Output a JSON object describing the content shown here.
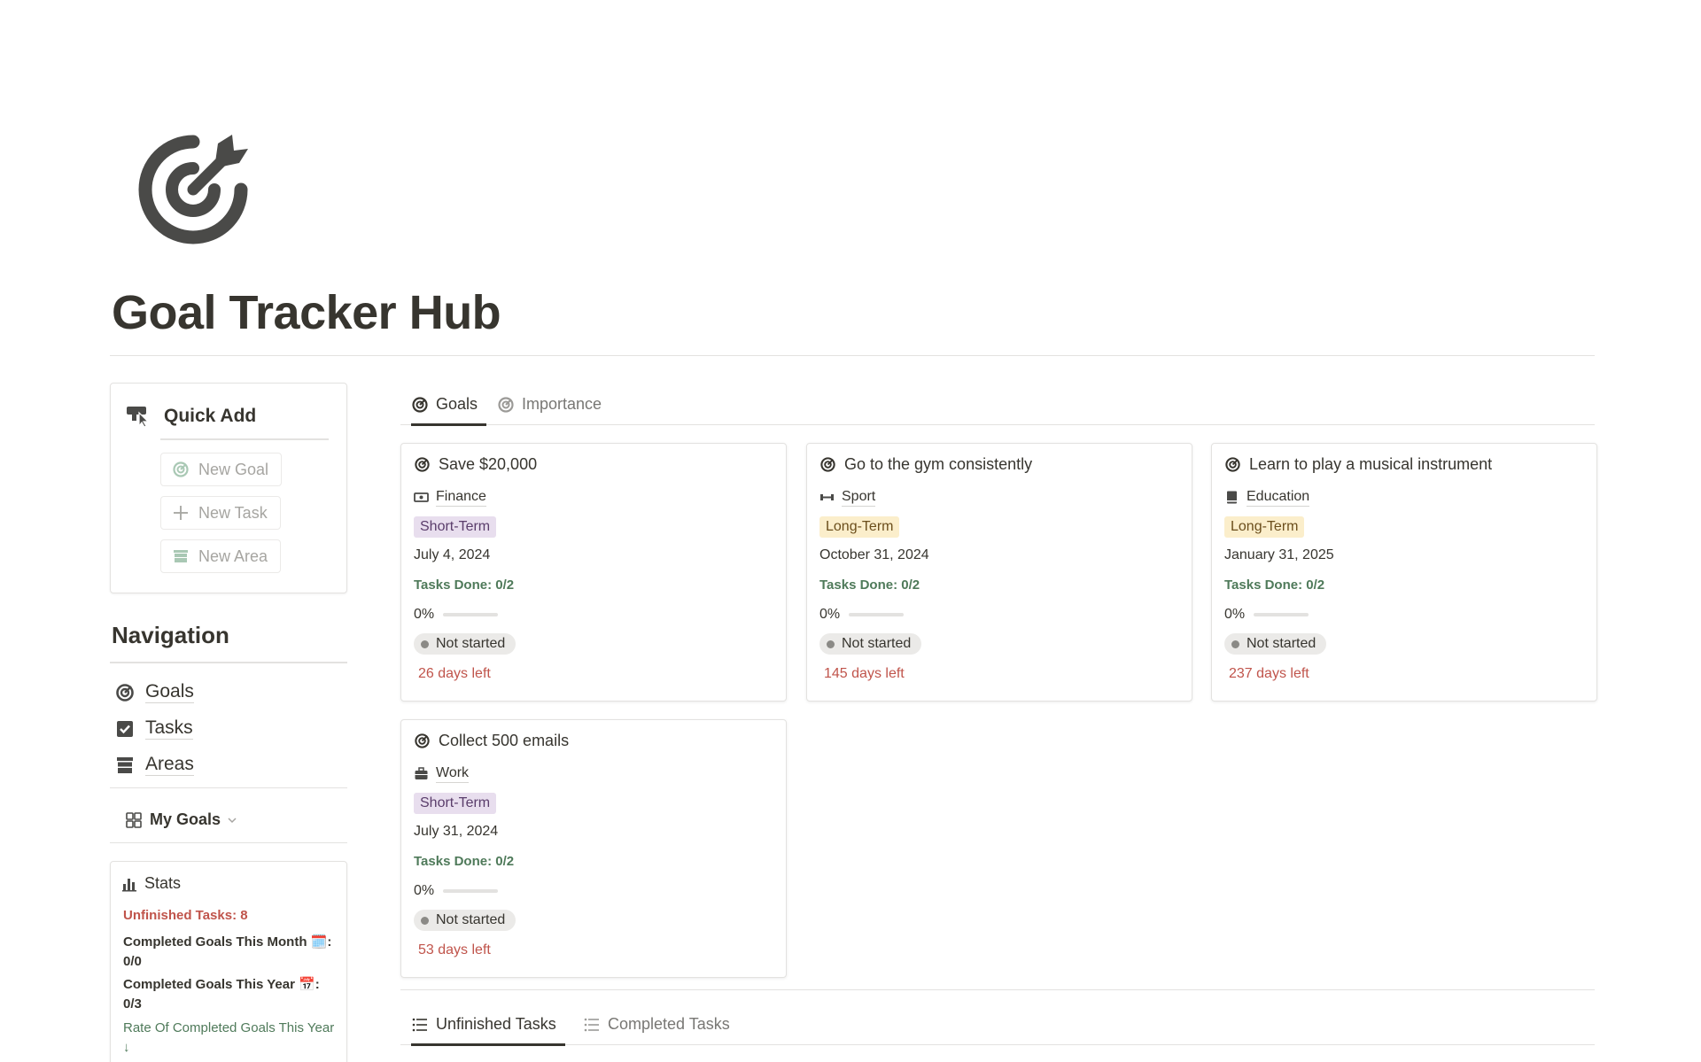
{
  "page": {
    "title": "Goal Tracker Hub",
    "icon": "target-arrow-icon"
  },
  "quick_add": {
    "title": "Quick Add",
    "buttons": [
      {
        "label": "New Goal",
        "icon": "target-icon"
      },
      {
        "label": "New Task",
        "icon": "plus-icon"
      },
      {
        "label": "New Area",
        "icon": "archive-icon"
      }
    ]
  },
  "navigation": {
    "title": "Navigation",
    "items": [
      {
        "label": "Goals",
        "icon": "target-icon"
      },
      {
        "label": "Tasks",
        "icon": "checkbox-icon"
      },
      {
        "label": "Areas",
        "icon": "archive-icon"
      }
    ],
    "view_switcher": {
      "label": "My Goals",
      "icon": "gallery-icon"
    }
  },
  "stats": {
    "title": "Stats",
    "unfinished_tasks": "Unfinished Tasks: 8",
    "completed_month": "Completed Goals This Month 🗓️: 0/0",
    "completed_year": "Completed Goals This Year 📅: 0/3",
    "rate_label": "Rate Of Completed Goals This Year ↓"
  },
  "goal_tabs": [
    {
      "label": "Goals",
      "active": true
    },
    {
      "label": "Importance",
      "active": false
    }
  ],
  "goals": [
    {
      "title": "Save $20,000",
      "area": "Finance",
      "area_icon": "money-icon",
      "term": "Short-Term",
      "date": "July 4, 2024",
      "tasks": "Tasks Done: 0/2",
      "percent_label": "0%",
      "progress": 0,
      "status": "Not started",
      "days_left": "26 days left"
    },
    {
      "title": "Go to the gym consistently",
      "area": "Sport",
      "area_icon": "dumbbell-icon",
      "term": "Long-Term",
      "date": "October 31, 2024",
      "tasks": "Tasks Done: 0/2",
      "percent_label": "0%",
      "progress": 0,
      "status": "Not started",
      "days_left": "145 days left"
    },
    {
      "title": "Learn to play a musical instrument",
      "area": "Education",
      "area_icon": "book-icon",
      "term": "Long-Term",
      "date": "January 31, 2025",
      "tasks": "Tasks Done: 0/2",
      "percent_label": "0%",
      "progress": 0,
      "status": "Not started",
      "days_left": "237 days left"
    },
    {
      "title": "Collect 500 emails",
      "area": "Work",
      "area_icon": "briefcase-icon",
      "term": "Short-Term",
      "date": "July 31, 2024",
      "tasks": "Tasks Done: 0/2",
      "percent_label": "0%",
      "progress": 0,
      "status": "Not started",
      "days_left": "53 days left"
    }
  ],
  "task_tabs": [
    {
      "label": "Unfinished Tasks",
      "active": true
    },
    {
      "label": "Completed Tasks",
      "active": false
    }
  ],
  "colors": {
    "short_term_bg": "#e8deee",
    "short_term_fg": "#5a3d6b",
    "long_term_bg": "#fbeecb",
    "long_term_fg": "#6b4e1c",
    "tasks_done": "#4f7a5a",
    "days_left": "#c0544b",
    "status_bg": "#ebeae8"
  }
}
